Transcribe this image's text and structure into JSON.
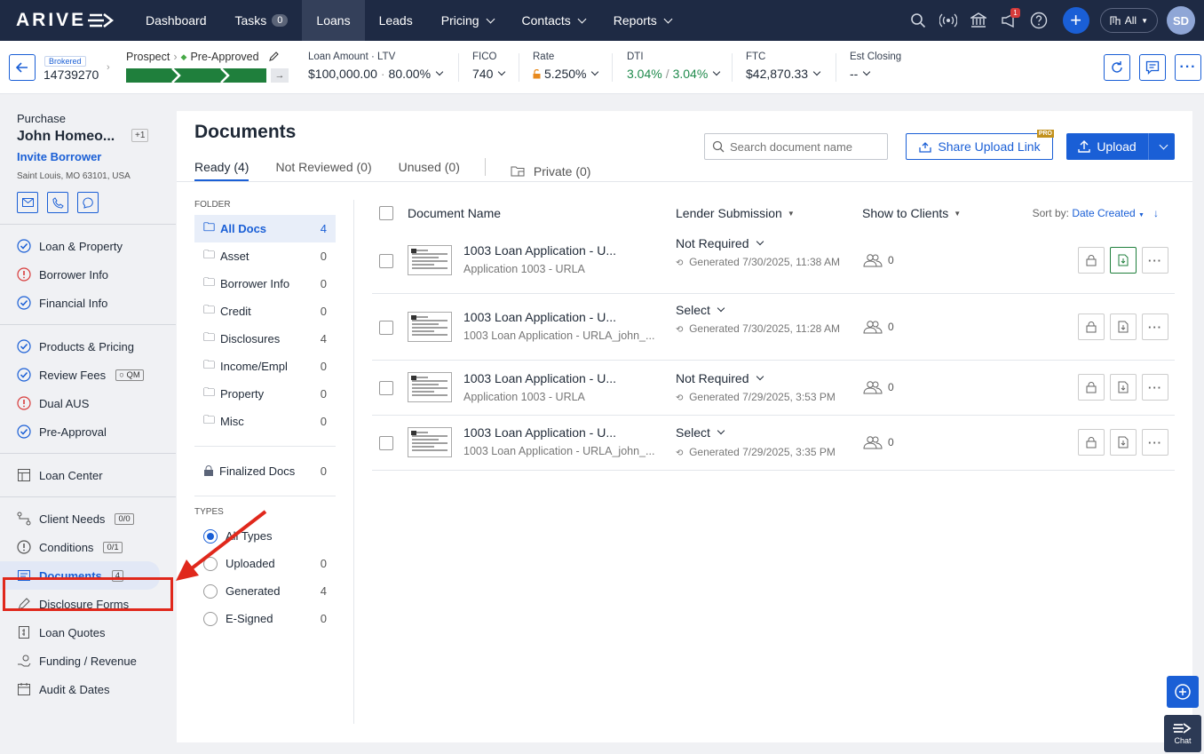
{
  "topnav": {
    "logo": "ARIVE",
    "items": [
      {
        "label": "Dashboard"
      },
      {
        "label": "Tasks",
        "count": "0"
      },
      {
        "label": "Loans"
      },
      {
        "label": "Leads"
      },
      {
        "label": "Pricing"
      },
      {
        "label": "Contacts"
      },
      {
        "label": "Reports"
      }
    ],
    "notif_badge": "1",
    "company_filter": "All",
    "avatar_initials": "SD"
  },
  "loanbar": {
    "brokered_tag": "Brokered",
    "loan_number": "14739270",
    "stage_from": "Prospect",
    "stage_to": "Pre-Approved",
    "metrics": [
      {
        "label": "Loan Amount · LTV",
        "value": "$100,000.00",
        "value2": "80.00%"
      },
      {
        "label": "FICO",
        "value": "740"
      },
      {
        "label": "Rate",
        "value": "5.250%"
      },
      {
        "label": "DTI",
        "value": "3.04%",
        "sep": "/",
        "value2": "3.04%"
      },
      {
        "label": "FTC",
        "value": "$42,870.33"
      },
      {
        "label": "Est Closing",
        "value": "--"
      }
    ]
  },
  "sidebar": {
    "loan_type": "Purchase",
    "borrower_name": "John Homeo...",
    "extra_borrowers": "+1",
    "invite": "Invite Borrower",
    "address": "Saint Louis, MO 63101, USA",
    "items": [
      {
        "label": "Loan & Property",
        "status": "done"
      },
      {
        "label": "Borrower Info",
        "status": "warn"
      },
      {
        "label": "Financial Info",
        "status": "done"
      },
      {
        "label": "Products & Pricing",
        "status": "done"
      },
      {
        "label": "Review Fees",
        "status": "done",
        "tag": "QM"
      },
      {
        "label": "Dual AUS",
        "status": "warn"
      },
      {
        "label": "Pre-Approval",
        "status": "done"
      },
      {
        "label": "Loan Center"
      },
      {
        "label": "Client Needs",
        "badge": "0/0"
      },
      {
        "label": "Conditions",
        "badge": "0/1"
      },
      {
        "label": "Documents",
        "badge": "4"
      },
      {
        "label": "Disclosure Forms"
      },
      {
        "label": "Loan Quotes"
      },
      {
        "label": "Funding / Revenue"
      },
      {
        "label": "Audit & Dates"
      }
    ]
  },
  "documents": {
    "title": "Documents",
    "tabs": [
      "Ready (4)",
      "Not Reviewed (0)",
      "Unused (0)",
      "Private (0)"
    ],
    "search_placeholder": "Search document name",
    "share_label": "Share Upload Link",
    "pro_tag": "PRO",
    "upload_label": "Upload",
    "folder_heading": "FOLDER",
    "folders": [
      {
        "name": "All Docs",
        "count": "4"
      },
      {
        "name": "Asset",
        "count": "0"
      },
      {
        "name": "Borrower Info",
        "count": "0"
      },
      {
        "name": "Credit",
        "count": "0"
      },
      {
        "name": "Disclosures",
        "count": "4"
      },
      {
        "name": "Income/Empl",
        "count": "0"
      },
      {
        "name": "Property",
        "count": "0"
      },
      {
        "name": "Misc",
        "count": "0"
      }
    ],
    "finalized": {
      "name": "Finalized Docs",
      "count": "0"
    },
    "types_heading": "TYPES",
    "types": [
      {
        "name": "All Types",
        "count": ""
      },
      {
        "name": "Uploaded",
        "count": "0"
      },
      {
        "name": "Generated",
        "count": "4"
      },
      {
        "name": "E-Signed",
        "count": "0"
      }
    ],
    "columns": {
      "name": "Document Name",
      "lender": "Lender Submission",
      "clients": "Show to Clients",
      "sort_label": "Sort by:",
      "sort_value": "Date Created"
    },
    "rows": [
      {
        "name": "1003 Loan Application - U...",
        "sub": "Application 1003 - URLA",
        "lender": "Not Required",
        "generated": "Generated 7/30/2025, 11:38 AM",
        "clients": "0"
      },
      {
        "name": "1003 Loan Application - U...",
        "sub": "1003 Loan Application - URLA_john_...",
        "lender": "Select",
        "generated": "Generated 7/30/2025, 11:28 AM",
        "clients": "0"
      },
      {
        "name": "1003 Loan Application - U...",
        "sub": "Application 1003 - URLA",
        "lender": "Not Required",
        "generated": "Generated 7/29/2025, 3:53 PM",
        "clients": "0"
      },
      {
        "name": "1003 Loan Application - U...",
        "sub": "1003 Loan Application - URLA_john_...",
        "lender": "Select",
        "generated": "Generated 7/29/2025, 3:35 PM",
        "clients": "0"
      }
    ]
  },
  "chat_label": "Chat",
  "colors": {
    "nav_bg": "#1e2a44",
    "accent": "#1a5fd6",
    "success": "#1f7f3c",
    "annotation": "#e0281c"
  }
}
